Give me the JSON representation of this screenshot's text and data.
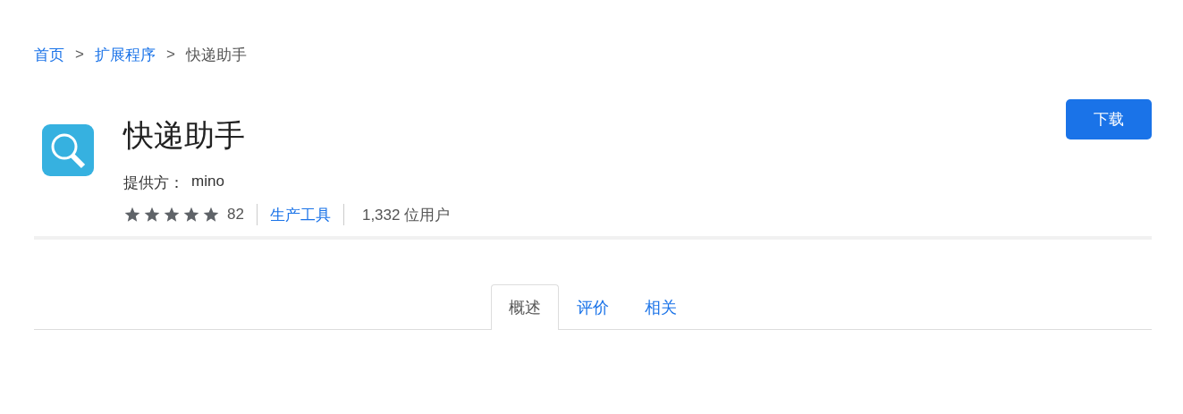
{
  "breadcrumb": [
    {
      "label": "首页",
      "kind": "link"
    },
    {
      "label": "扩展程序",
      "kind": "link"
    },
    {
      "label": "快递助手",
      "kind": "current"
    }
  ],
  "breadcrumb_separator": ">",
  "extension": {
    "name": "快递助手",
    "provider_label": "提供方：",
    "provider": "mino",
    "stars": 5,
    "rating_count": "82",
    "category": "生产工具",
    "users": "1,332 位用户"
  },
  "download_button": "下载",
  "tabs": [
    {
      "label": "概述",
      "selected": true
    },
    {
      "label": "评价",
      "selected": false
    },
    {
      "label": "相关",
      "selected": false
    }
  ]
}
